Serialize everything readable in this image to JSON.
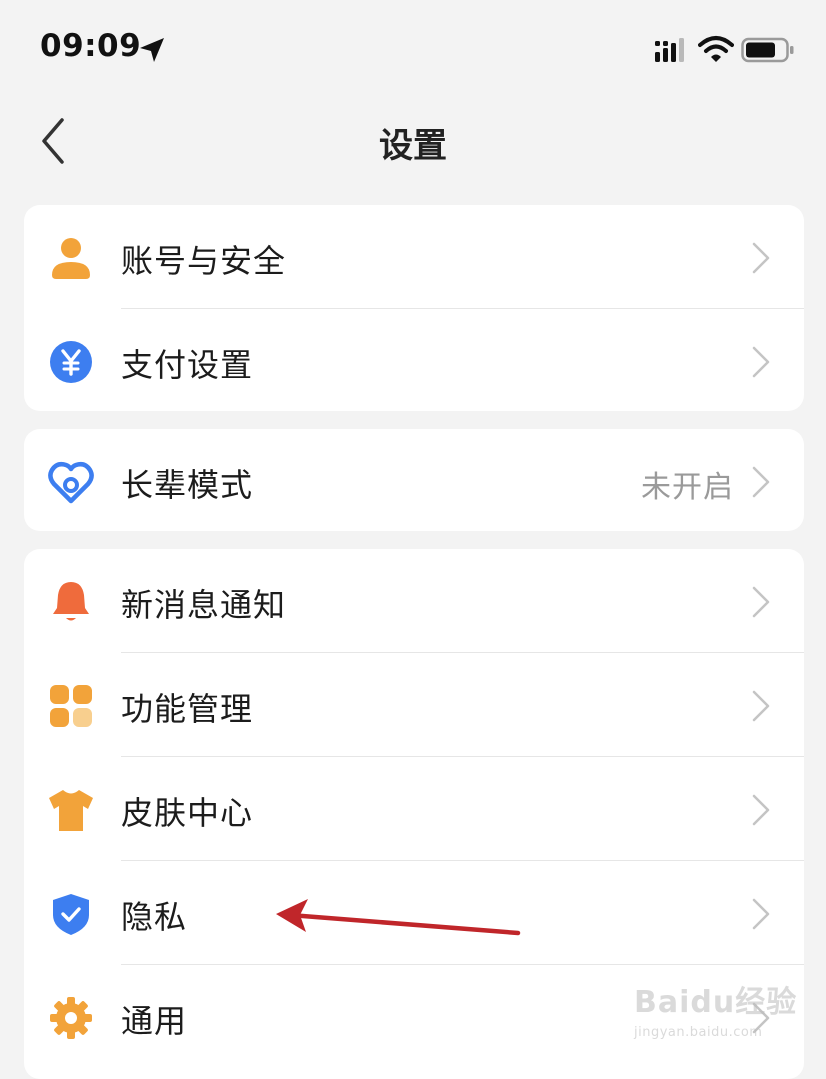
{
  "status_bar": {
    "time": "09:09",
    "icons": [
      "location-arrow-icon",
      "cellular-signal-icon",
      "wifi-icon",
      "battery-icon"
    ]
  },
  "nav": {
    "back_icon": "chevron-left-icon",
    "title": "设置"
  },
  "groups": [
    {
      "items": [
        {
          "icon": "user-icon",
          "label": "账号与安全",
          "value": ""
        },
        {
          "icon": "yuan-coin-icon",
          "label": "支付设置",
          "value": ""
        }
      ]
    },
    {
      "items": [
        {
          "icon": "heart-care-icon",
          "label": "长辈模式",
          "value": "未开启"
        }
      ]
    },
    {
      "items": [
        {
          "icon": "bell-icon",
          "label": "新消息通知",
          "value": ""
        },
        {
          "icon": "grid-apps-icon",
          "label": "功能管理",
          "value": ""
        },
        {
          "icon": "tshirt-icon",
          "label": "皮肤中心",
          "value": ""
        },
        {
          "icon": "shield-check-icon",
          "label": "隐私",
          "value": ""
        },
        {
          "icon": "gear-icon",
          "label": "通用",
          "value": ""
        }
      ]
    }
  ],
  "colors": {
    "background": "#f3f3f3",
    "card": "#ffffff",
    "orange": "#f2a33a",
    "blue": "#3d7ef0",
    "red_orange": "#ef6b3c",
    "arrow_red": "#c0262a",
    "secondary_text": "#9a9a9a"
  },
  "watermark": {
    "main": "Baidu经验",
    "sub": "jingyan.baidu.com"
  }
}
